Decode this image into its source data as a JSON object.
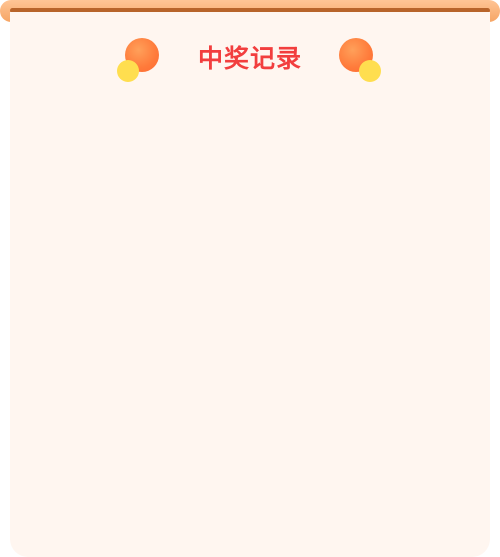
{
  "dialog": {
    "title": "中奖记录"
  },
  "records": [],
  "colors": {
    "rod": "#f6a565",
    "panel": "#fff6f0",
    "title": "#f23e3e",
    "decor_orange": "#ff7a3a",
    "decor_yellow": "#ffde4f"
  },
  "icons": {
    "left_decoration": "orange-yellow-balls-icon",
    "right_decoration": "orange-yellow-balls-icon"
  }
}
